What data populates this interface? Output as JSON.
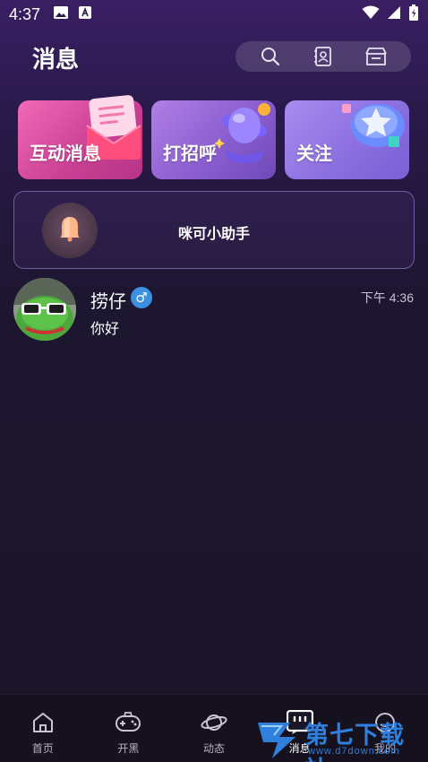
{
  "status_bar": {
    "time": "4:37",
    "left_icons": [
      "image-icon",
      "font-icon"
    ],
    "right_icons": [
      "wifi-icon",
      "signal-icon",
      "battery-icon"
    ]
  },
  "header": {
    "title": "消息",
    "actions": [
      {
        "name": "search-icon"
      },
      {
        "name": "contacts-icon"
      },
      {
        "name": "shop-icon"
      }
    ]
  },
  "cards": [
    {
      "label": "互动消息",
      "color": "#e04fa0"
    },
    {
      "label": "打招呼",
      "color": "#8a5ed0"
    },
    {
      "label": "关注",
      "color": "#8c70e0"
    }
  ],
  "assistant": {
    "name": "咪可小助手"
  },
  "chats": [
    {
      "name": "捞仔",
      "gender": "♂",
      "time": "下午 4:36",
      "preview": "你好"
    }
  ],
  "tabs": [
    {
      "label": "首页",
      "icon": "home-icon",
      "active": false
    },
    {
      "label": "开黑",
      "icon": "gamepad-icon",
      "active": false
    },
    {
      "label": "动态",
      "icon": "planet-icon",
      "active": false
    },
    {
      "label": "消息",
      "icon": "message-icon",
      "active": true
    },
    {
      "label": "我的",
      "icon": "profile-icon",
      "active": false
    }
  ],
  "watermark": {
    "text": "第七下载站",
    "url": "www.d7down.com",
    "color": "#2f7fdc"
  }
}
